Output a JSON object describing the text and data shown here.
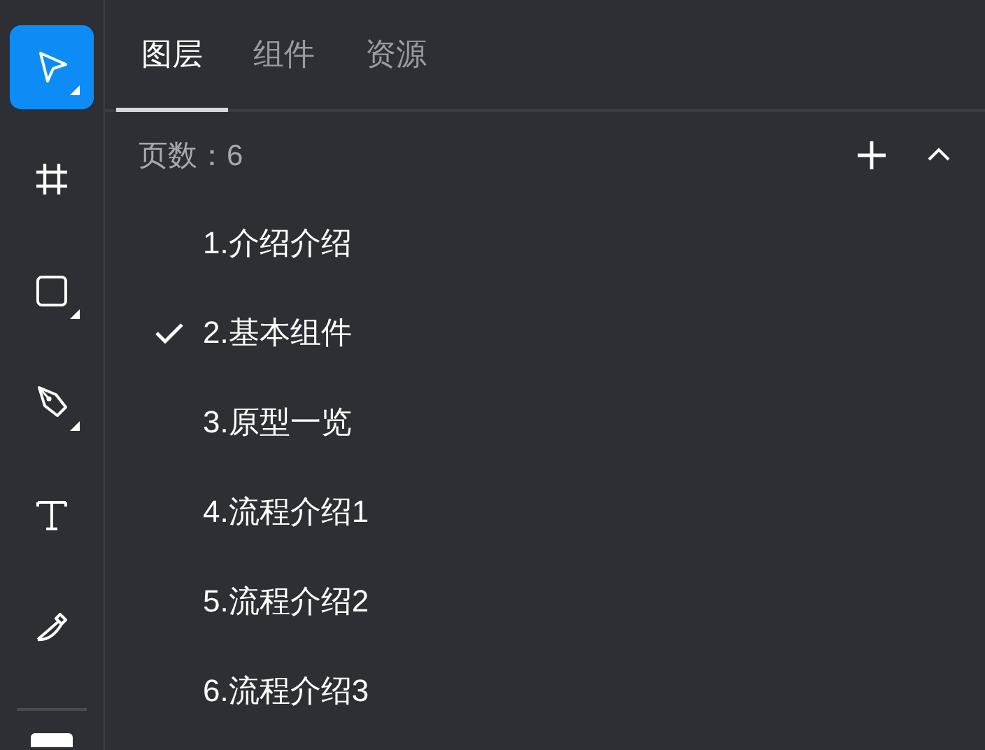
{
  "toolbar": {
    "tools": [
      {
        "kind": "select",
        "selected": true,
        "submenu": true
      },
      {
        "kind": "frame",
        "selected": false,
        "submenu": false
      },
      {
        "kind": "rect",
        "selected": false,
        "submenu": true
      },
      {
        "kind": "pen",
        "selected": false,
        "submenu": true
      },
      {
        "kind": "text",
        "selected": false,
        "submenu": false
      },
      {
        "kind": "knife",
        "selected": false,
        "submenu": false
      }
    ]
  },
  "tabs": [
    {
      "label": "图层",
      "selected": true
    },
    {
      "label": "组件",
      "selected": false
    },
    {
      "label": "资源",
      "selected": false
    }
  ],
  "pages_header": {
    "label": "页数：6"
  },
  "pages": [
    {
      "name": "1.介绍介绍",
      "selected": false
    },
    {
      "name": "2.基本组件",
      "selected": true
    },
    {
      "name": "3.原型一览",
      "selected": false
    },
    {
      "name": "4.流程介绍1",
      "selected": false
    },
    {
      "name": "5.流程介绍2",
      "selected": false
    },
    {
      "name": "6.流程介绍3",
      "selected": false
    }
  ]
}
